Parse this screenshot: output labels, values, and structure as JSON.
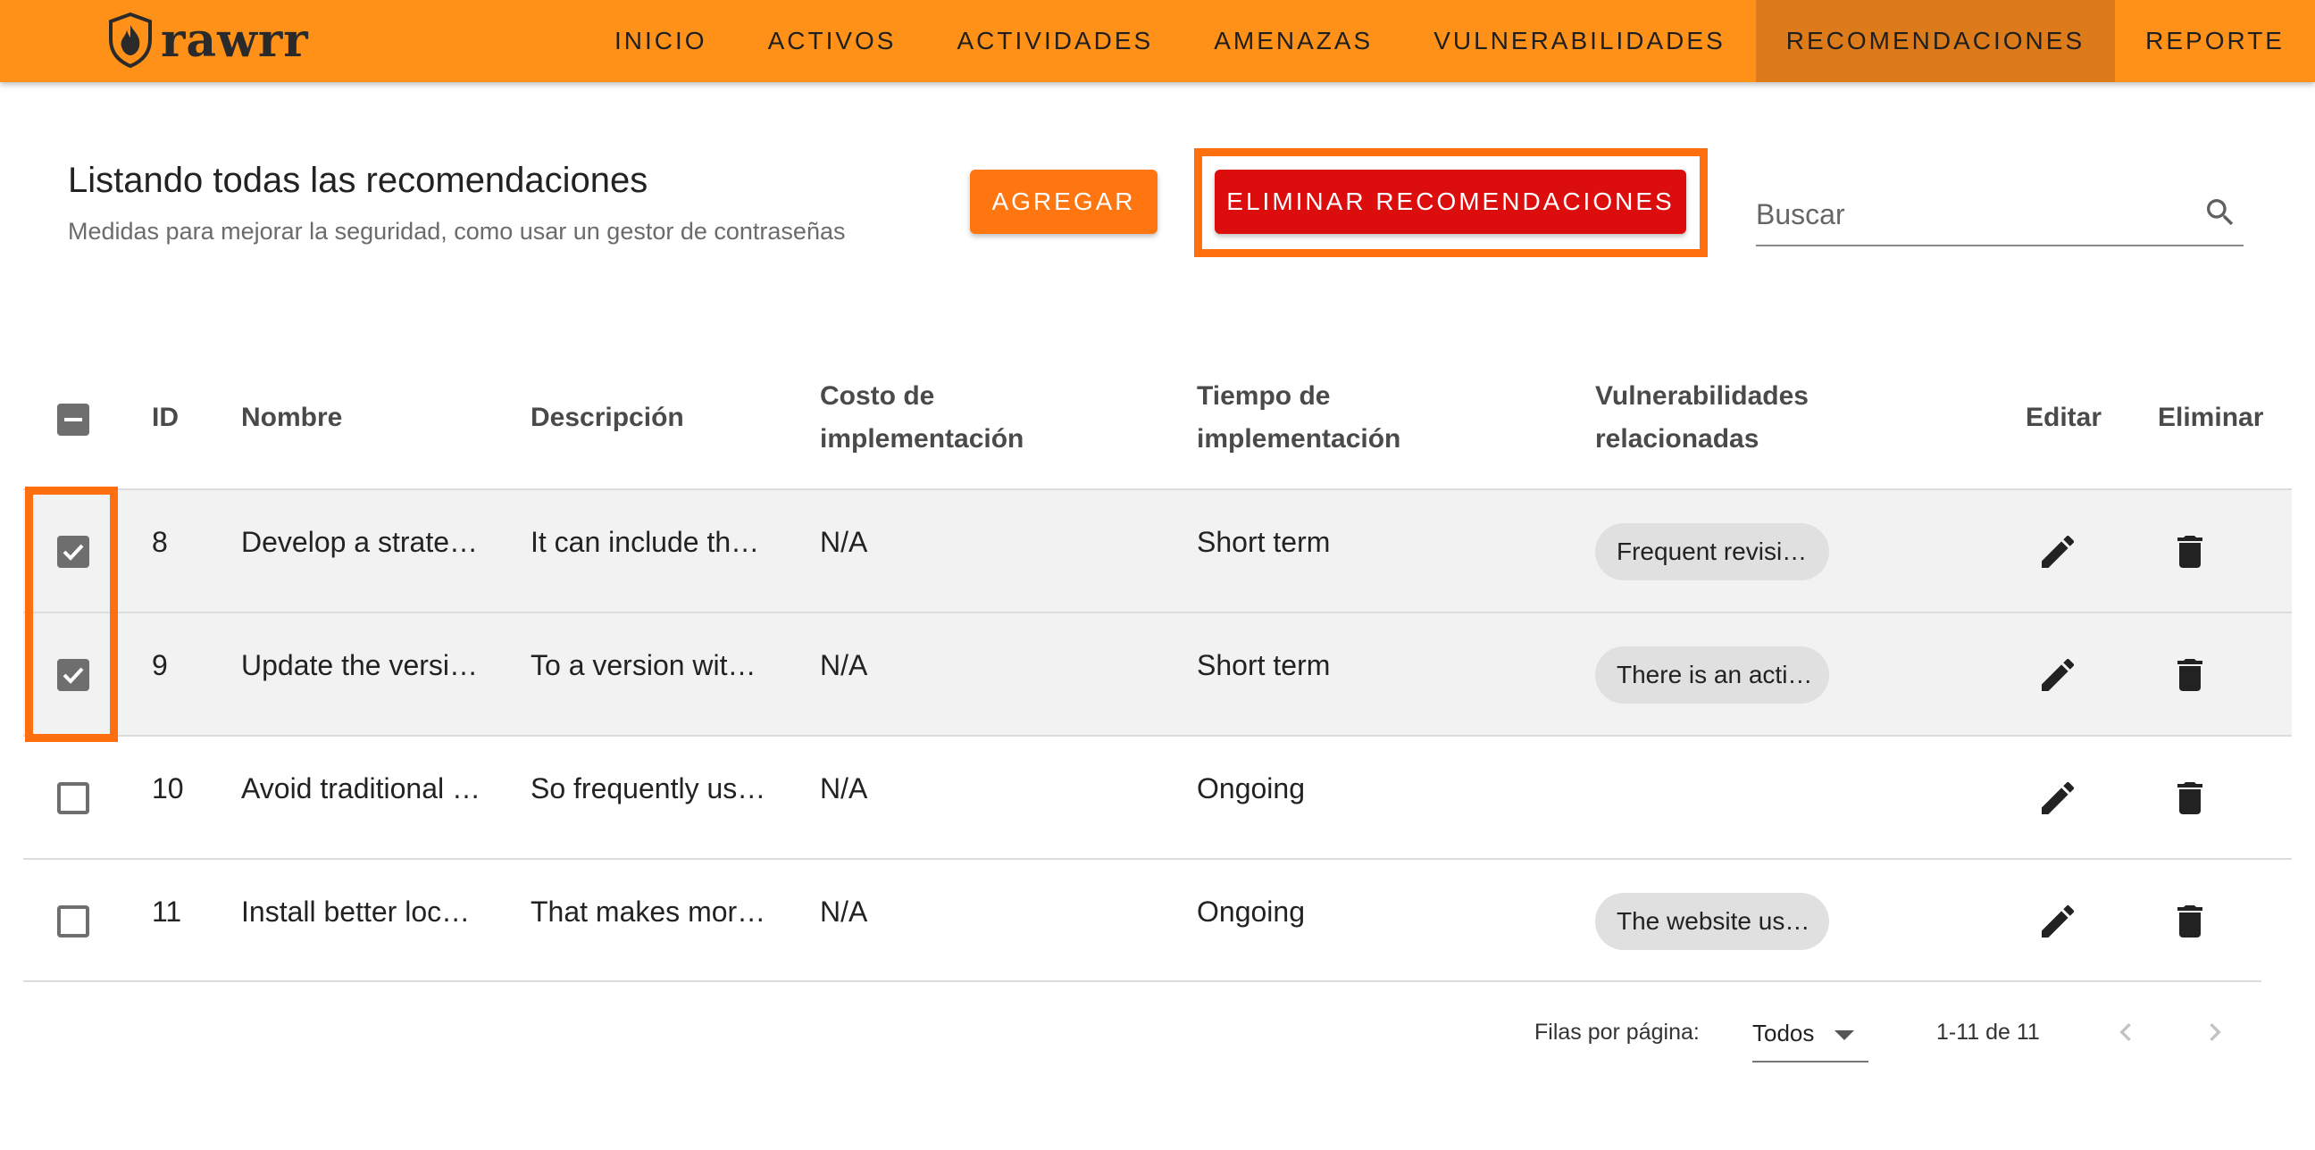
{
  "app": {
    "logo_text": "rawrr"
  },
  "nav": {
    "items": [
      {
        "label": "INICIO"
      },
      {
        "label": "ACTIVOS"
      },
      {
        "label": "ACTIVIDADES"
      },
      {
        "label": "AMENAZAS"
      },
      {
        "label": "VULNERABILIDADES"
      },
      {
        "label": "RECOMENDACIONES"
      },
      {
        "label": "REPORTE"
      }
    ],
    "active": "RECOMENDACIONES"
  },
  "header": {
    "title": "Listando todas las recomendaciones",
    "subtitle": "Medidas para mejorar la seguridad, como usar un gestor de contraseñas",
    "add_label": "AGREGAR",
    "delete_label": "ELIMINAR RECOMENDACIONES"
  },
  "search": {
    "placeholder": "Buscar",
    "icon": "search-icon"
  },
  "table": {
    "columns": {
      "id": "ID",
      "name": "Nombre",
      "description": "Descripción",
      "cost_1": "Costo de",
      "cost_2": "implementación",
      "time_1": "Tiempo de",
      "time_2": "implementación",
      "vuln_1": "Vulnerabilidades",
      "vuln_2": "relacionadas",
      "edit": "Editar",
      "delete": "Eliminar"
    },
    "header_checkbox": "indeterminate",
    "rows": [
      {
        "checked": true,
        "id": "8",
        "name": "Develop a strate…",
        "description": "It can include th…",
        "cost": "N/A",
        "time": "Short term",
        "vuln": "Frequent revisi…"
      },
      {
        "checked": true,
        "id": "9",
        "name": "Update the versi…",
        "description": "To a version wit…",
        "cost": "N/A",
        "time": "Short term",
        "vuln": "There is an acti…"
      },
      {
        "checked": false,
        "id": "10",
        "name": "Avoid traditional …",
        "description": "So frequently us…",
        "cost": "N/A",
        "time": "Ongoing",
        "vuln": ""
      },
      {
        "checked": false,
        "id": "11",
        "name": "Install better loc…",
        "description": "That makes mor…",
        "cost": "N/A",
        "time": "Ongoing",
        "vuln": "The website us…"
      }
    ]
  },
  "footer": {
    "rows_per_page_label": "Filas por página:",
    "rows_per_page_value": "Todos",
    "range": "1-11 de 11"
  },
  "colors": {
    "appbar": "#ff9119",
    "nav_active": "#dd7b1a",
    "add_button": "#ff7510",
    "delete_button": "#db0d0d",
    "highlight": "#ff6f0f"
  }
}
